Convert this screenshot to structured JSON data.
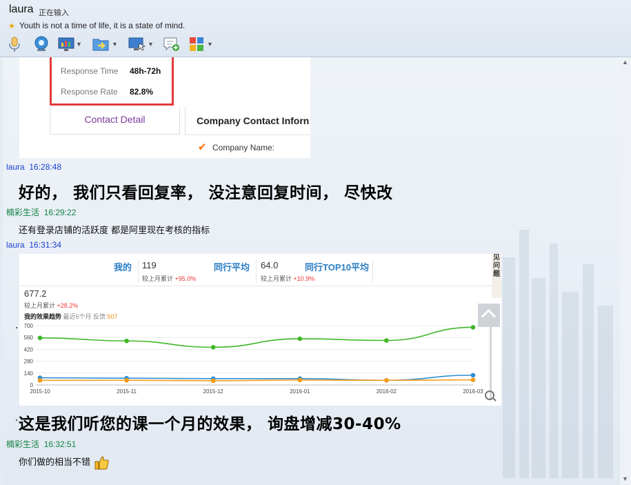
{
  "header": {
    "contact_name": "laura",
    "typing_status": "正在输入",
    "signature": "Youth is not a time of life, it is a state of mind."
  },
  "toolbar": {
    "icons": [
      "microphone-icon",
      "webcam-icon",
      "screen-share-icon",
      "send-file-icon",
      "remote-desktop-icon",
      "message-add-icon",
      "apps-icon"
    ]
  },
  "card1": {
    "response_time_label": "Response Time",
    "response_time_value": "48h-72h",
    "response_rate_label": "Response Rate",
    "response_rate_value": "82.8%",
    "contact_detail": "Contact Detail",
    "company_contact_title": "Company Contact Inforn",
    "company_name_label": "Company Name:"
  },
  "messages": [
    {
      "sender": "laura",
      "time": "16:28:48",
      "text": "好的， 我们只看回复率， 没注意回复时间， 尽快改"
    },
    {
      "sender": "楠彩生活",
      "time": "16:29:22",
      "text": "还有登录店铺的活跃度 都是阿里现在考核的指标"
    },
    {
      "sender": "laura",
      "time": "16:31:34",
      "text": "这是我们听您的课一个月的效果， 询盘增减30-40%"
    },
    {
      "sender": "楠彩生活",
      "time": "16:32:51",
      "text": "你们做的相当不错"
    }
  ],
  "card2": {
    "my_label": "我的",
    "my_value": "119",
    "my_change_label": "较上月累计",
    "my_change": "+95.0%",
    "industry_avg_label": "同行平均",
    "industry_avg_value": "64.0",
    "industry_avg_change_label": "较上月累计",
    "industry_avg_change": "+10.9%",
    "top10_label": "同行TOP10平均",
    "top10_value": "677.2",
    "top10_change_label": "较上月累计",
    "top10_change": "+28.2%",
    "trend_title": "我的效果趋势",
    "trend_sub": "最近6个月 反馈:",
    "trend_sub_value": "507",
    "side_text": "见问题"
  },
  "chart_data": {
    "type": "line",
    "categories": [
      "2015-10",
      "2015-11",
      "2015-12",
      "2016-01",
      "2016-02",
      "2016-03"
    ],
    "yticks": [
      0,
      140,
      280,
      420,
      560,
      700
    ],
    "ylim": [
      0,
      700
    ],
    "series": [
      {
        "color": "#3fb728",
        "values": [
          555,
          520,
          445,
          545,
          525,
          680
        ]
      },
      {
        "color": "#2b8fd6",
        "values": [
          85,
          80,
          75,
          75,
          55,
          115
        ]
      },
      {
        "color": "#f39a19",
        "values": [
          55,
          55,
          50,
          58,
          55,
          60
        ]
      }
    ]
  }
}
